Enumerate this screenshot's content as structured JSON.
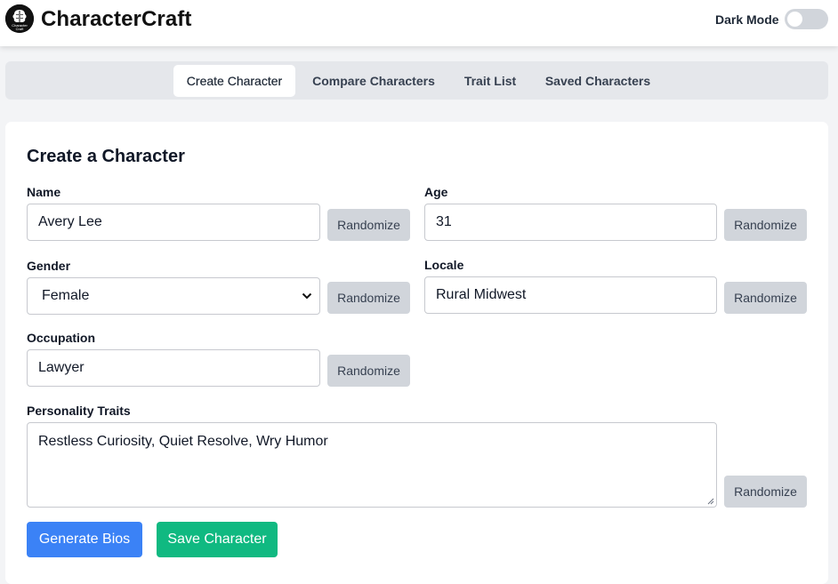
{
  "app": {
    "name": "CharacterCraft",
    "logo_text": "Character Craft",
    "dark_mode_label": "Dark Mode",
    "dark_mode_on": false
  },
  "tabs": [
    {
      "label": "Create Character",
      "active": true
    },
    {
      "label": "Compare Characters",
      "active": false
    },
    {
      "label": "Trait List",
      "active": false
    },
    {
      "label": "Saved Characters",
      "active": false
    }
  ],
  "form": {
    "title": "Create a Character",
    "randomize_label": "Randomize",
    "name": {
      "label": "Name",
      "value": "Avery Lee"
    },
    "age": {
      "label": "Age",
      "value": "31"
    },
    "gender": {
      "label": "Gender",
      "value": "Female"
    },
    "locale": {
      "label": "Locale",
      "value": "Rural Midwest"
    },
    "occupation": {
      "label": "Occupation",
      "value": "Lawyer"
    },
    "traits": {
      "label": "Personality Traits",
      "value": "Restless Curiosity, Quiet Resolve, Wry Humor"
    },
    "generate_label": "Generate Bios",
    "save_label": "Save Character"
  },
  "colors": {
    "primary": "#3b82f6",
    "success": "#10b981",
    "secondary_button": "#d1d5db"
  }
}
